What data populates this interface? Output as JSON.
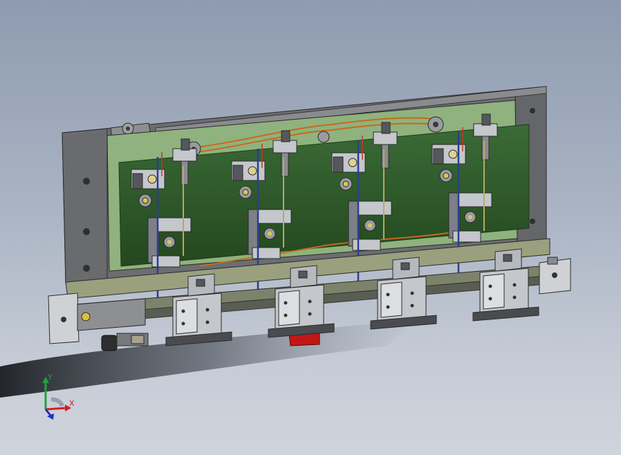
{
  "viewport": {
    "background_top": "#8e9bb0",
    "background_bottom": "#cfd4dc"
  },
  "model": {
    "colors": {
      "frame": "#6c6d70",
      "frame_dark": "#4a4b4e",
      "plate_green": "#2e5a2c",
      "plate_green_light": "#8fb27e",
      "rail": "#9aa07e",
      "block": "#c4c7cc",
      "block_dark": "#55575c",
      "wire_orange": "#c86a1a",
      "rod_blue": "#2b3f8f",
      "red_part": "#c01818"
    },
    "station_count": 4
  },
  "triad": {
    "x_label": "X",
    "y_label": "Y",
    "x_color": "#d02020",
    "y_color": "#20a040",
    "z_color": "#2030c0",
    "icon": "coordinate-triad-icon"
  }
}
